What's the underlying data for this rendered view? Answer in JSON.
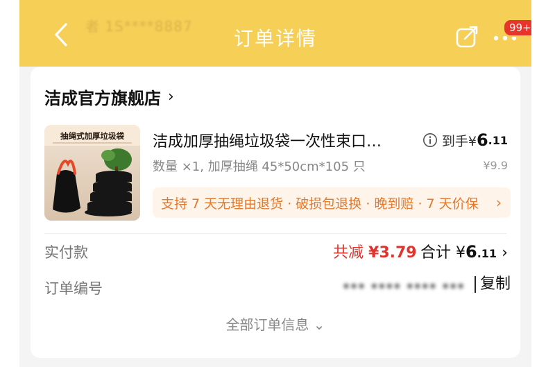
{
  "header": {
    "title": "订单详情",
    "ghost_text": "者 1S****8887",
    "badge": "99+",
    "colors": {
      "background": "#f6cf56",
      "badge": "#e8352b"
    }
  },
  "store": {
    "name": "洁成官方旗舰店",
    "chevron": "›"
  },
  "product": {
    "name": "洁成加厚抽绳垃圾袋一次性束口…",
    "spec": "数量 ×1, 加厚抽绳 45*50cm*105 只",
    "price_prefix": "到手¥",
    "price_int": "6",
    "price_dec": ".11",
    "original_price": "¥9.9",
    "image_caption": "抽绳式加厚垃圾袋",
    "guarantee": "支持 7 天无理由退货 · 破损包退换 · 晚到赔 · 7 天价保",
    "guarantee_arrow": "›"
  },
  "payment": {
    "label": "实付款",
    "saving_label": "共减",
    "saving_amount": "¥3.79",
    "total_label": "合计",
    "total_currency": "¥",
    "total_int": "6",
    "total_dec": ".11",
    "total_chevron": "›"
  },
  "order": {
    "label": "订单编号",
    "number": "*** **** **** ***",
    "copy_label": "复制"
  },
  "footer": {
    "all_info": "全部订单信息 ⌄"
  }
}
